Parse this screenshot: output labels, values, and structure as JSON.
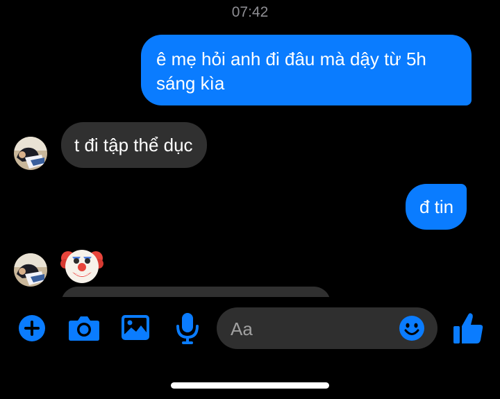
{
  "status": {
    "time": "07:42"
  },
  "messages": [
    {
      "direction": "outgoing",
      "text": "ê mẹ hỏi anh đi đâu mà dậy từ 5h sáng kìa"
    },
    {
      "direction": "incoming",
      "text": "t đi tập thể dục"
    },
    {
      "direction": "outgoing",
      "text": "đ tin"
    },
    {
      "direction": "incoming",
      "emoji": "clown-face"
    }
  ],
  "composer": {
    "placeholder": "Aa",
    "icons": [
      "plus-icon",
      "camera-icon",
      "gallery-icon",
      "microphone-icon",
      "emoji-icon",
      "thumbs-up-icon"
    ]
  },
  "colors": {
    "accent": "#0a7cff",
    "incoming_bubble": "#303030",
    "input_bg": "#2f2f2f",
    "background": "#000000"
  }
}
